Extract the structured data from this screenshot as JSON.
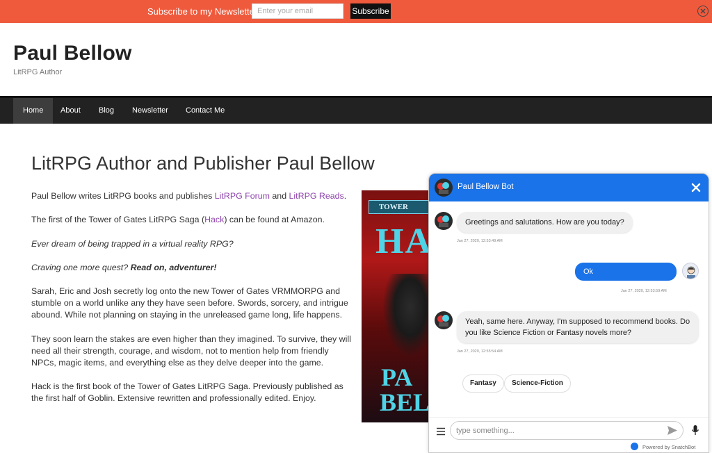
{
  "newsletter": {
    "text": "Subscribe to my Newsletter",
    "placeholder": "Enter your email",
    "button": "Subscribe"
  },
  "site": {
    "title": "Paul Bellow",
    "tagline": "LitRPG Author"
  },
  "nav": {
    "items": [
      {
        "label": "Home",
        "active": true
      },
      {
        "label": "About"
      },
      {
        "label": "Blog"
      },
      {
        "label": "Newsletter"
      },
      {
        "label": "Contact Me"
      }
    ]
  },
  "article": {
    "title": "LitRPG Author and Publisher Paul Bellow",
    "p1_pre": "Paul Bellow writes LitRPG books and publishes ",
    "p1_link1": "LitRPG Forum",
    "p1_mid": " and ",
    "p1_link2": "LitRPG Reads",
    "p1_end": ".",
    "p2_pre": "The first of the Tower of Gates LitRPG Saga (",
    "p2_link": "Hack",
    "p2_post": ") can be found at Amazon.",
    "p3": "Ever dream of being trapped in a virtual reality RPG?",
    "p4_pre": "Craving one more quest? ",
    "p4_bold": "Read on, adventurer!",
    "p5": "Sarah, Eric and Josh secretly log onto the new Tower of Gates VRMMORPG and stumble on a world unlike any they have seen before. Swords, sorcery, and intrigue abound. While not planning on staying in the unreleased game long, life happens.",
    "p6": "They soon learn the stakes are even higher than they imagined. To survive, they will need all their strength, courage, and wisdom, not to mention help from friendly NPCs, magic items, and everything else as they delve deeper into the game.",
    "p7": "Hack is the first book of the Tower of Gates LitRPG Saga. Previously published as the first half of Goblin. Extensive rewritten and professionally edited. Enjoy."
  },
  "cover": {
    "banner": "TOWER",
    "title": "HA",
    "author_line1": "PA",
    "author_line2": "BEL"
  },
  "chatbot": {
    "title": "Paul Bellow Bot",
    "messages": [
      {
        "from": "bot",
        "text": "Greetings and salutations. How are you today?",
        "time": "Jan 27, 2020, 12:53:49 AM"
      },
      {
        "from": "user",
        "text": "Ok",
        "time": "Jan 27, 2020, 12:53:59 AM"
      },
      {
        "from": "bot",
        "text": "Yeah, same here. Anyway, I'm supposed to recommend books. Do you like Science Fiction or Fantasy novels more?",
        "time": "Jan 27, 2020, 12:55:54 AM"
      }
    ],
    "chips": [
      "Fantasy",
      "Science-Fiction"
    ],
    "input_placeholder": "type something...",
    "powered_by": "Powered by SnatchBot"
  },
  "colors": {
    "newsletter_bg": "#ef5a3c",
    "nav_bg": "#222222",
    "chat_accent": "#1a73e8",
    "link": "#8e44ad"
  }
}
